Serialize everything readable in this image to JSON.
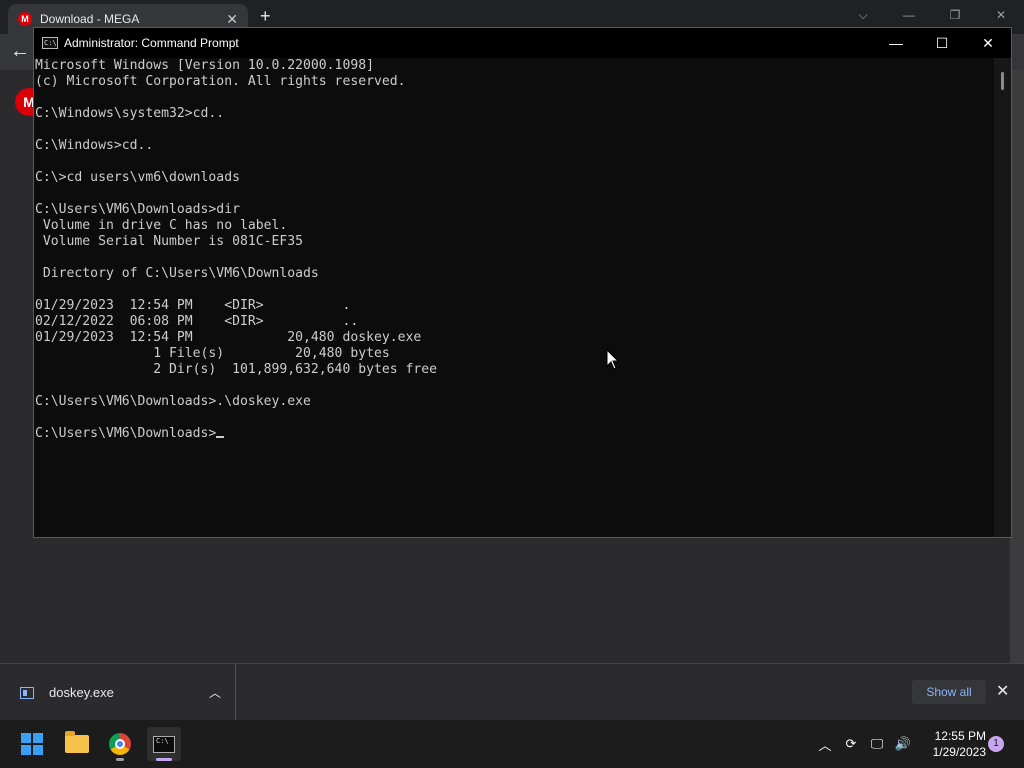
{
  "browser": {
    "tab_title": "Download - MEGA",
    "tab_close": "✕",
    "new_tab": "+",
    "logo_letter": "M"
  },
  "cmd": {
    "window_title": "Administrator: Command Prompt",
    "icon_text": "C:\\",
    "lines": [
      "Microsoft Windows [Version 10.0.22000.1098]",
      "(c) Microsoft Corporation. All rights reserved.",
      "",
      "C:\\Windows\\system32>cd..",
      "",
      "C:\\Windows>cd..",
      "",
      "C:\\>cd users\\vm6\\downloads",
      "",
      "C:\\Users\\VM6\\Downloads>dir",
      " Volume in drive C has no label.",
      " Volume Serial Number is 081C-EF35",
      "",
      " Directory of C:\\Users\\VM6\\Downloads",
      "",
      "01/29/2023  12:54 PM    <DIR>          .",
      "02/12/2022  06:08 PM    <DIR>          ..",
      "01/29/2023  12:54 PM            20,480 doskey.exe",
      "               1 File(s)         20,480 bytes",
      "               2 Dir(s)  101,899,632,640 bytes free",
      "",
      "C:\\Users\\VM6\\Downloads>.\\doskey.exe",
      ""
    ],
    "prompt": "C:\\Users\\VM6\\Downloads>"
  },
  "downloads": {
    "file_name": "doskey.exe",
    "show_all": "Show all"
  },
  "taskbar": {
    "time": "12:55 PM",
    "date": "1/29/2023",
    "notification_count": "1"
  },
  "colors": {
    "console_bg": "#0c0c0c",
    "console_text": "#cccccc",
    "accent": "#8ab4f8"
  }
}
